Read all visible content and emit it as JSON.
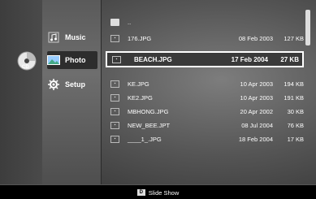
{
  "source": {
    "disc_label": "CD"
  },
  "menu": {
    "items": [
      {
        "label": "Music",
        "icon": "music-icon"
      },
      {
        "label": "Photo",
        "icon": "photo-icon",
        "active": true
      },
      {
        "label": "Setup",
        "icon": "gear-icon"
      }
    ]
  },
  "files": {
    "parent": "..",
    "rows": [
      {
        "name": "176.JPG",
        "date": "08 Feb 2003",
        "size": "127 KB"
      },
      {
        "name": "BEACH.JPG",
        "date": "17 Feb 2004",
        "size": "27 KB",
        "selected": true
      },
      {
        "name": "KE.JPG",
        "date": "10 Apr 2003",
        "size": "194 KB"
      },
      {
        "name": "KE2.JPG",
        "date": "10 Apr 2003",
        "size": "191 KB"
      },
      {
        "name": "MBHONG.JPG",
        "date": "20 Apr 2002",
        "size": "30 KB"
      },
      {
        "name": "NEW_BEE.JPT",
        "date": "08 Jul 2004",
        "size": "76 KB"
      },
      {
        "name": "____1_.JPG",
        "date": "18 Feb 2004",
        "size": "17 KB"
      }
    ]
  },
  "footer": {
    "key": "D",
    "label": "Slide Show"
  }
}
